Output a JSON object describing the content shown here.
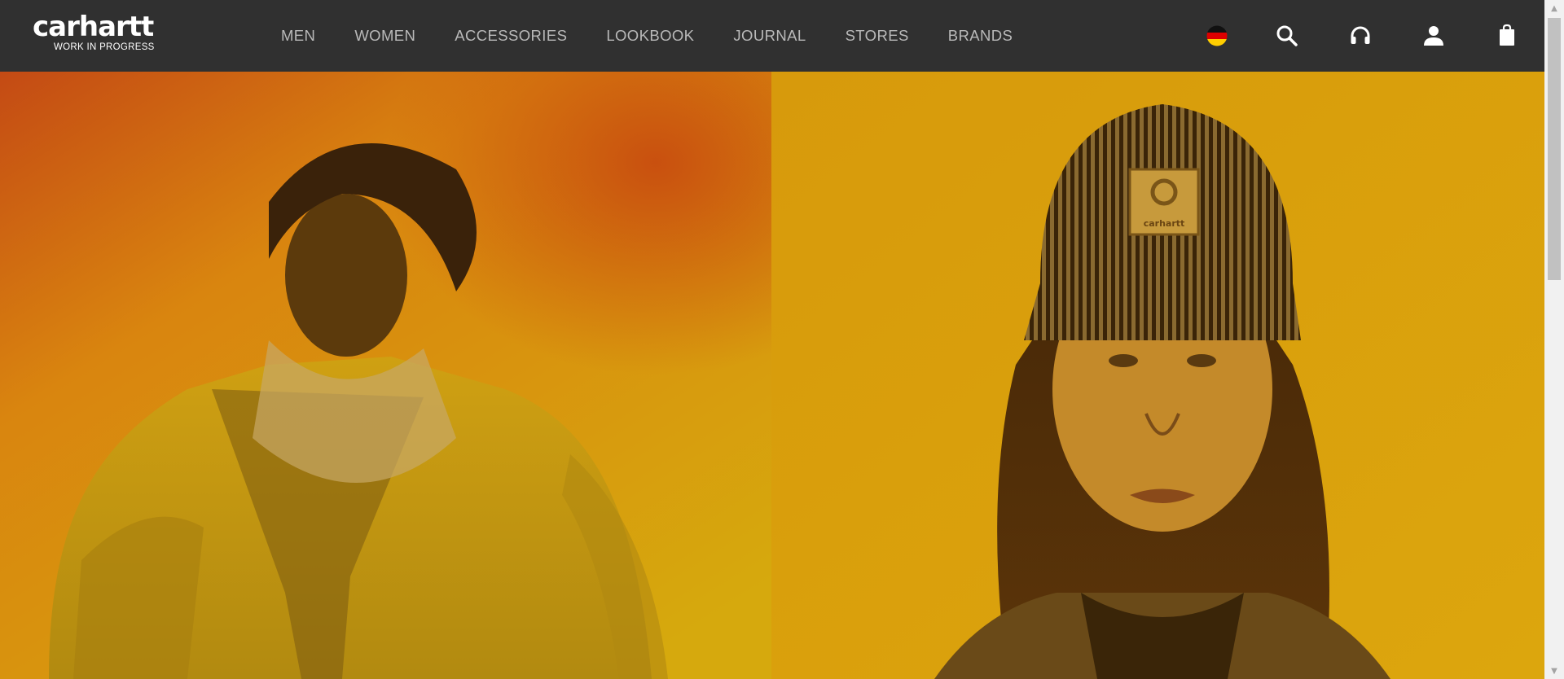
{
  "brand": {
    "wordmark": "carhartt",
    "tagline": "WORK IN PROGRESS"
  },
  "nav": {
    "items": [
      "MEN",
      "WOMEN",
      "ACCESSORIES",
      "LOOKBOOK",
      "JOURNAL",
      "STORES",
      "BRANDS"
    ]
  },
  "header_icons": [
    "flag-germany-icon",
    "search-icon",
    "headphones-icon",
    "user-icon",
    "shopping-bag-icon"
  ],
  "colors": {
    "header_bg": "#303030",
    "nav_text": "#b9b9b9",
    "hero_tint": "#d9a00f",
    "hero_accent": "#c4501a"
  },
  "hero": {
    "beanie_label": "carhartt"
  }
}
